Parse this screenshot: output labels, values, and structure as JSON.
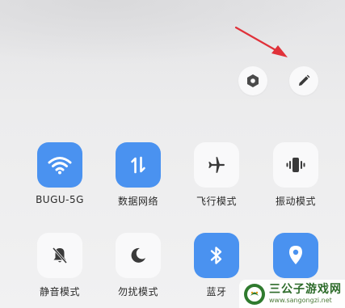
{
  "header": {
    "settings_button": {
      "icon": "settings-hexagon-icon"
    },
    "edit_button": {
      "icon": "pencil-edit-icon"
    }
  },
  "tiles": [
    {
      "label": "BUGU-5G",
      "icon": "wifi-icon",
      "state": "on"
    },
    {
      "label": "数据网络",
      "icon": "mobile-data-arrows-icon",
      "state": "on"
    },
    {
      "label": "飞行模式",
      "icon": "airplane-icon",
      "state": "off"
    },
    {
      "label": "振动模式",
      "icon": "vibrate-phone-icon",
      "state": "off"
    },
    {
      "label": "静音模式",
      "icon": "bell-muted-icon",
      "state": "off"
    },
    {
      "label": "勿扰模式",
      "icon": "moon-icon",
      "state": "off"
    },
    {
      "label": "蓝牙",
      "icon": "bluetooth-icon",
      "state": "on"
    },
    {
      "label": "",
      "icon": "location-pin-icon",
      "state": "on"
    }
  ],
  "watermark": {
    "title": "三公子游戏网",
    "url": "www.sangongzi.net"
  },
  "colors": {
    "accent_on": "#4a92f0",
    "tile_off": "#f9f9fa",
    "annotation_arrow": "#e0323a"
  }
}
